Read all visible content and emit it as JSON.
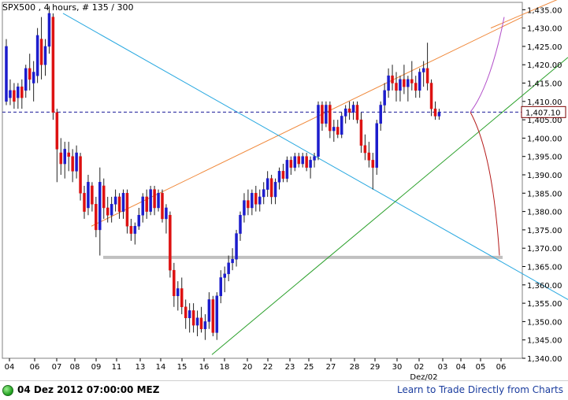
{
  "chart_title": "SPX500 , 4 hours, # 135 / 300",
  "status": {
    "datetime": "04 Dez 2012 07:00:00 MEZ",
    "link": "Learn to Trade Directly from Charts"
  },
  "colors": {
    "bull": "#1c1ccc",
    "bear": "#dd1111",
    "resistance": "#f0883a",
    "down_trend": "#28a8e0",
    "up_trend": "#2aa02a",
    "support": "#c0c0c0",
    "current_price_line": "#1a1a99",
    "projection_up": "#b24fc9",
    "projection_down": "#b51a1a"
  },
  "chart_data": {
    "type": "candlestick",
    "symbol": "SPX500",
    "timeframe": "4 hours",
    "ylim": [
      1340,
      1437
    ],
    "y_ticks": [
      "1,435.00",
      "1,430.00",
      "1,425.00",
      "1,420.00",
      "1,415.00",
      "1,410.00",
      "1,405.00",
      "1,400.00",
      "1,395.00",
      "1,390.00",
      "1,385.00",
      "1,380.00",
      "1,375.00",
      "1,370.00",
      "1,365.00",
      "1,360.00",
      "1,355.00",
      "1,350.00",
      "1,345.00",
      "1,340.00"
    ],
    "x_ticks": [
      "04",
      "06",
      "07",
      "08",
      "09",
      "11",
      "13",
      "14",
      "15",
      "16",
      "18",
      "20",
      "22",
      "23",
      "25",
      "27",
      "28",
      "29",
      "30",
      "02",
      "03",
      "04",
      "05",
      "06"
    ],
    "x_sublabel": "Dez/02",
    "current_price": 1407.1,
    "current_price_label": "1,407.10",
    "support_level": 1367.5,
    "candles": [
      {
        "o": 1410,
        "h": 1427,
        "l": 1409,
        "c": 1425
      },
      {
        "o": 1411,
        "h": 1416,
        "l": 1409,
        "c": 1413
      },
      {
        "o": 1413,
        "h": 1415,
        "l": 1408,
        "c": 1410
      },
      {
        "o": 1411,
        "h": 1415,
        "l": 1408,
        "c": 1414
      },
      {
        "o": 1414,
        "h": 1416,
        "l": 1408,
        "c": 1411
      },
      {
        "o": 1413,
        "h": 1420,
        "l": 1411,
        "c": 1419
      },
      {
        "o": 1419,
        "h": 1423,
        "l": 1413,
        "c": 1416
      },
      {
        "o": 1415,
        "h": 1421,
        "l": 1410,
        "c": 1418
      },
      {
        "o": 1417,
        "h": 1430,
        "l": 1415,
        "c": 1428
      },
      {
        "o": 1427,
        "h": 1433,
        "l": 1416,
        "c": 1420
      },
      {
        "o": 1420,
        "h": 1427,
        "l": 1417,
        "c": 1425
      },
      {
        "o": 1425,
        "h": 1436,
        "l": 1423,
        "c": 1434
      },
      {
        "o": 1433,
        "h": 1434,
        "l": 1405,
        "c": 1407
      },
      {
        "o": 1407,
        "h": 1408,
        "l": 1388,
        "c": 1397
      },
      {
        "o": 1396,
        "h": 1400,
        "l": 1390,
        "c": 1393
      },
      {
        "o": 1393,
        "h": 1399,
        "l": 1389,
        "c": 1397
      },
      {
        "o": 1396,
        "h": 1399,
        "l": 1391,
        "c": 1395
      },
      {
        "o": 1395,
        "h": 1397,
        "l": 1388,
        "c": 1391
      },
      {
        "o": 1391,
        "h": 1398,
        "l": 1389,
        "c": 1396
      },
      {
        "o": 1395,
        "h": 1396,
        "l": 1383,
        "c": 1385
      },
      {
        "o": 1385,
        "h": 1387,
        "l": 1378,
        "c": 1380
      },
      {
        "o": 1381,
        "h": 1390,
        "l": 1379,
        "c": 1388
      },
      {
        "o": 1387,
        "h": 1388,
        "l": 1380,
        "c": 1382
      },
      {
        "o": 1382,
        "h": 1384,
        "l": 1373,
        "c": 1375
      },
      {
        "o": 1375,
        "h": 1392,
        "l": 1368,
        "c": 1388
      },
      {
        "o": 1387,
        "h": 1389,
        "l": 1378,
        "c": 1381
      },
      {
        "o": 1381,
        "h": 1384,
        "l": 1377,
        "c": 1379
      },
      {
        "o": 1379,
        "h": 1384,
        "l": 1377,
        "c": 1382
      },
      {
        "o": 1382,
        "h": 1386,
        "l": 1380,
        "c": 1384
      },
      {
        "o": 1384,
        "h": 1385,
        "l": 1378,
        "c": 1380
      },
      {
        "o": 1380,
        "h": 1386,
        "l": 1378,
        "c": 1385
      },
      {
        "o": 1385,
        "h": 1386,
        "l": 1374,
        "c": 1376
      },
      {
        "o": 1376,
        "h": 1378,
        "l": 1372,
        "c": 1374
      },
      {
        "o": 1374,
        "h": 1377,
        "l": 1371,
        "c": 1376
      },
      {
        "o": 1376,
        "h": 1381,
        "l": 1375,
        "c": 1379
      },
      {
        "o": 1379,
        "h": 1385,
        "l": 1377,
        "c": 1384
      },
      {
        "o": 1384,
        "h": 1386,
        "l": 1378,
        "c": 1380
      },
      {
        "o": 1380,
        "h": 1387,
        "l": 1379,
        "c": 1386
      },
      {
        "o": 1386,
        "h": 1387,
        "l": 1379,
        "c": 1381
      },
      {
        "o": 1381,
        "h": 1386,
        "l": 1380,
        "c": 1385
      },
      {
        "o": 1385,
        "h": 1386,
        "l": 1377,
        "c": 1378
      },
      {
        "o": 1378,
        "h": 1382,
        "l": 1374,
        "c": 1381
      },
      {
        "o": 1379,
        "h": 1380,
        "l": 1362,
        "c": 1364
      },
      {
        "o": 1364,
        "h": 1366,
        "l": 1354,
        "c": 1357
      },
      {
        "o": 1357,
        "h": 1361,
        "l": 1353,
        "c": 1359
      },
      {
        "o": 1359,
        "h": 1362,
        "l": 1352,
        "c": 1354
      },
      {
        "o": 1354,
        "h": 1356,
        "l": 1348,
        "c": 1351
      },
      {
        "o": 1351,
        "h": 1355,
        "l": 1347,
        "c": 1353
      },
      {
        "o": 1353,
        "h": 1355,
        "l": 1347,
        "c": 1349
      },
      {
        "o": 1349,
        "h": 1353,
        "l": 1346,
        "c": 1351
      },
      {
        "o": 1351,
        "h": 1354,
        "l": 1347,
        "c": 1348
      },
      {
        "o": 1348,
        "h": 1352,
        "l": 1345,
        "c": 1350
      },
      {
        "o": 1350,
        "h": 1358,
        "l": 1348,
        "c": 1356
      },
      {
        "o": 1356,
        "h": 1357,
        "l": 1346,
        "c": 1347
      },
      {
        "o": 1347,
        "h": 1358,
        "l": 1345,
        "c": 1357
      },
      {
        "o": 1357,
        "h": 1364,
        "l": 1355,
        "c": 1362
      },
      {
        "o": 1362,
        "h": 1365,
        "l": 1358,
        "c": 1363
      },
      {
        "o": 1363,
        "h": 1368,
        "l": 1361,
        "c": 1366
      },
      {
        "o": 1366,
        "h": 1370,
        "l": 1364,
        "c": 1367
      },
      {
        "o": 1367,
        "h": 1375,
        "l": 1365,
        "c": 1374
      },
      {
        "o": 1374,
        "h": 1380,
        "l": 1372,
        "c": 1379
      },
      {
        "o": 1379,
        "h": 1385,
        "l": 1377,
        "c": 1383
      },
      {
        "o": 1383,
        "h": 1386,
        "l": 1379,
        "c": 1381
      },
      {
        "o": 1381,
        "h": 1386,
        "l": 1379,
        "c": 1385
      },
      {
        "o": 1385,
        "h": 1387,
        "l": 1380,
        "c": 1382
      },
      {
        "o": 1382,
        "h": 1386,
        "l": 1380,
        "c": 1384
      },
      {
        "o": 1384,
        "h": 1388,
        "l": 1382,
        "c": 1386
      },
      {
        "o": 1386,
        "h": 1391,
        "l": 1384,
        "c": 1389
      },
      {
        "o": 1389,
        "h": 1390,
        "l": 1382,
        "c": 1384
      },
      {
        "o": 1384,
        "h": 1389,
        "l": 1382,
        "c": 1388
      },
      {
        "o": 1388,
        "h": 1392,
        "l": 1386,
        "c": 1391
      },
      {
        "o": 1391,
        "h": 1393,
        "l": 1388,
        "c": 1389
      },
      {
        "o": 1389,
        "h": 1395,
        "l": 1388,
        "c": 1394
      },
      {
        "o": 1394,
        "h": 1395,
        "l": 1390,
        "c": 1392
      },
      {
        "o": 1392,
        "h": 1396,
        "l": 1391,
        "c": 1395
      },
      {
        "o": 1395,
        "h": 1396,
        "l": 1392,
        "c": 1393
      },
      {
        "o": 1393,
        "h": 1396,
        "l": 1392,
        "c": 1395
      },
      {
        "o": 1395,
        "h": 1396,
        "l": 1391,
        "c": 1392
      },
      {
        "o": 1392,
        "h": 1395,
        "l": 1389,
        "c": 1394
      },
      {
        "o": 1394,
        "h": 1396,
        "l": 1392,
        "c": 1395
      },
      {
        "o": 1395,
        "h": 1410,
        "l": 1394,
        "c": 1409
      },
      {
        "o": 1409,
        "h": 1410,
        "l": 1402,
        "c": 1404
      },
      {
        "o": 1404,
        "h": 1410,
        "l": 1403,
        "c": 1409
      },
      {
        "o": 1409,
        "h": 1410,
        "l": 1400,
        "c": 1402
      },
      {
        "o": 1402,
        "h": 1405,
        "l": 1399,
        "c": 1403
      },
      {
        "o": 1403,
        "h": 1405,
        "l": 1400,
        "c": 1401
      },
      {
        "o": 1401,
        "h": 1407,
        "l": 1400,
        "c": 1406
      },
      {
        "o": 1406,
        "h": 1409,
        "l": 1404,
        "c": 1408
      },
      {
        "o": 1408,
        "h": 1410,
        "l": 1405,
        "c": 1407
      },
      {
        "o": 1407,
        "h": 1410,
        "l": 1405,
        "c": 1409
      },
      {
        "o": 1409,
        "h": 1410,
        "l": 1404,
        "c": 1405
      },
      {
        "o": 1405,
        "h": 1407,
        "l": 1396,
        "c": 1398
      },
      {
        "o": 1398,
        "h": 1401,
        "l": 1394,
        "c": 1396
      },
      {
        "o": 1396,
        "h": 1399,
        "l": 1392,
        "c": 1394
      },
      {
        "o": 1394,
        "h": 1396,
        "l": 1386,
        "c": 1392
      },
      {
        "o": 1392,
        "h": 1405,
        "l": 1390,
        "c": 1404
      },
      {
        "o": 1404,
        "h": 1410,
        "l": 1402,
        "c": 1409
      },
      {
        "o": 1409,
        "h": 1415,
        "l": 1407,
        "c": 1413
      },
      {
        "o": 1413,
        "h": 1419,
        "l": 1411,
        "c": 1417
      },
      {
        "o": 1417,
        "h": 1420,
        "l": 1413,
        "c": 1415
      },
      {
        "o": 1415,
        "h": 1418,
        "l": 1410,
        "c": 1413
      },
      {
        "o": 1413,
        "h": 1417,
        "l": 1410,
        "c": 1416
      },
      {
        "o": 1416,
        "h": 1420,
        "l": 1412,
        "c": 1414
      },
      {
        "o": 1414,
        "h": 1417,
        "l": 1410,
        "c": 1416
      },
      {
        "o": 1416,
        "h": 1421,
        "l": 1413,
        "c": 1415
      },
      {
        "o": 1415,
        "h": 1417,
        "l": 1411,
        "c": 1413
      },
      {
        "o": 1413,
        "h": 1419,
        "l": 1411,
        "c": 1418
      },
      {
        "o": 1418,
        "h": 1421,
        "l": 1414,
        "c": 1419
      },
      {
        "o": 1419,
        "h": 1426,
        "l": 1413,
        "c": 1415
      },
      {
        "o": 1415,
        "h": 1416,
        "l": 1406,
        "c": 1408
      },
      {
        "o": 1408,
        "h": 1410,
        "l": 1405,
        "c": 1406
      },
      {
        "o": 1406,
        "h": 1408,
        "l": 1405,
        "c": 1407
      }
    ]
  }
}
